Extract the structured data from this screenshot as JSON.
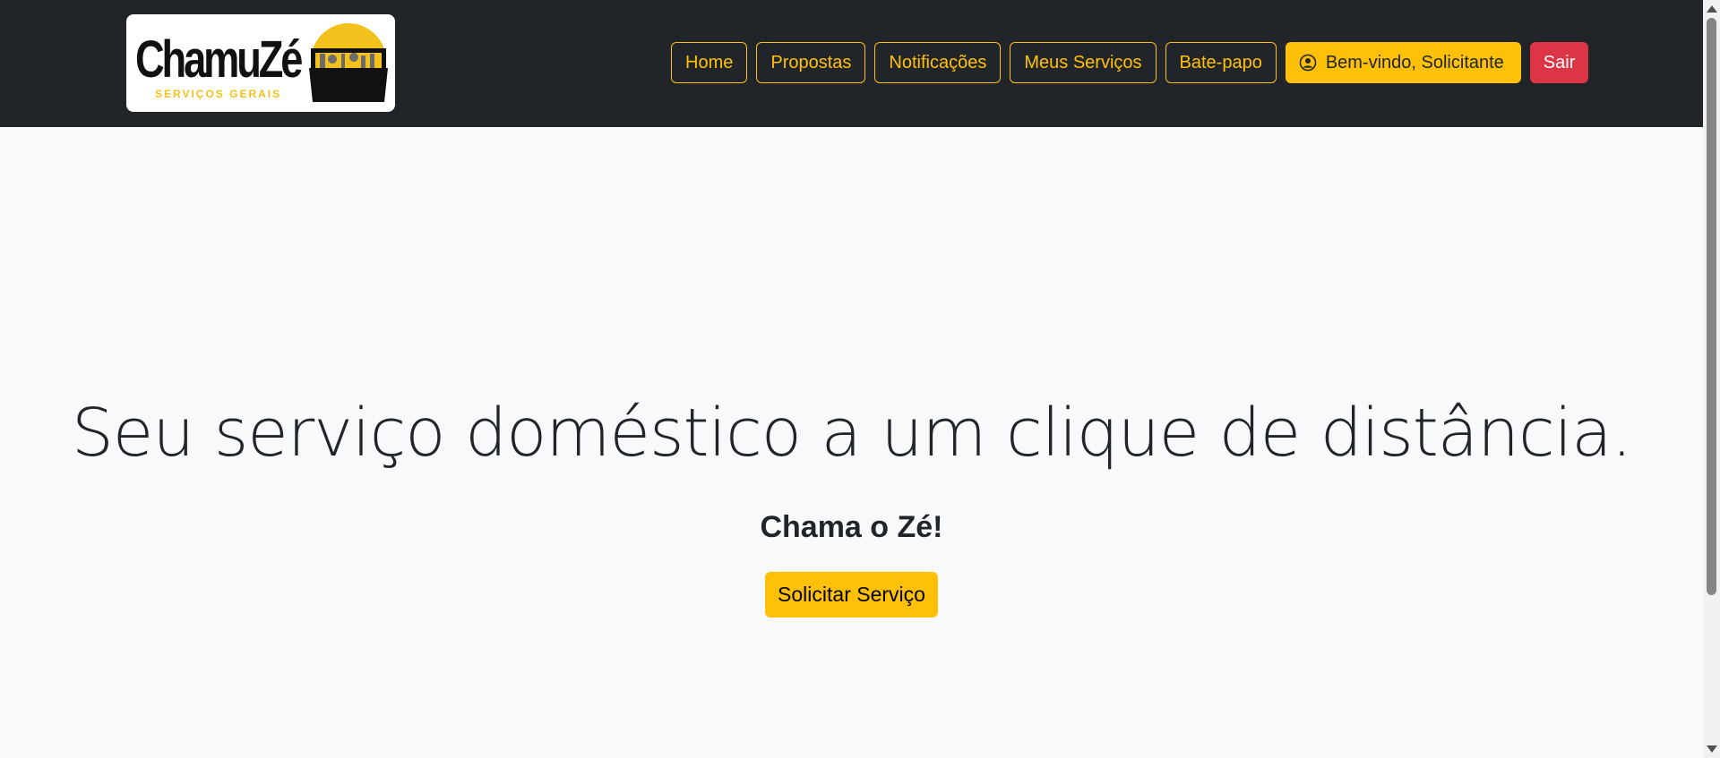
{
  "brand": {
    "name": "ChamuZé",
    "tagline": "SERVIÇOS GERAIS",
    "icon": "toolbox-icon",
    "accent_color": "#ffc107"
  },
  "nav": {
    "home": "Home",
    "proposals": "Propostas",
    "notifications": "Notificações",
    "my_services": "Meus Serviços",
    "chat": "Bate-papo",
    "welcome": "Bem-vindo, Solicitante",
    "welcome_icon": "user-circle-icon",
    "logout": "Sair",
    "logout_color": "#dc3545"
  },
  "hero": {
    "title": "Seu serviço doméstico a um clique de distância.",
    "subtitle": "Chama o Zé!",
    "cta": "Solicitar Serviço"
  }
}
